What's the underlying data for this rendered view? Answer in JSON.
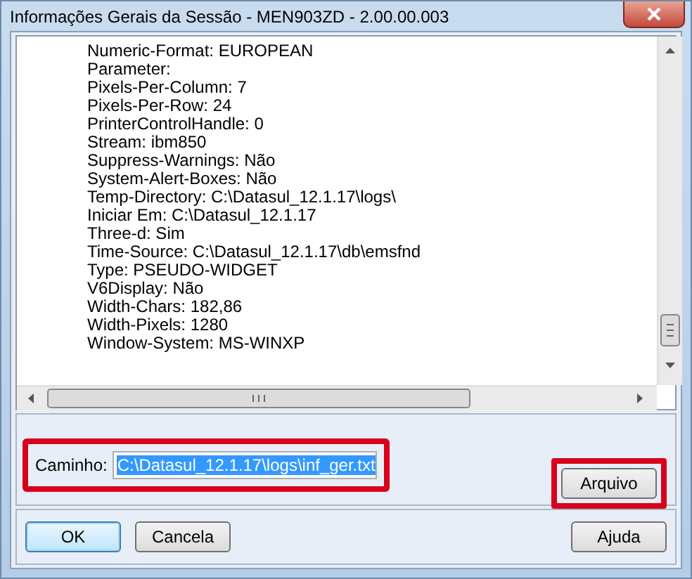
{
  "window": {
    "title": "Informações Gerais da Sessão - MEN903ZD - 2.00.00.003"
  },
  "lines": [
    "Numeric-Format: EUROPEAN",
    "Parameter:",
    "Pixels-Per-Column: 7",
    "Pixels-Per-Row: 24",
    "PrinterControlHandle: 0",
    "Stream: ibm850",
    "Suppress-Warnings: Não",
    "System-Alert-Boxes: Não",
    "Temp-Directory: C:\\Datasul_12.1.17\\logs\\",
    "Iniciar Em: C:\\Datasul_12.1.17",
    "Three-d: Sim",
    "Time-Source: C:\\Datasul_12.1.17\\db\\emsfnd",
    "Type: PSEUDO-WIDGET",
    "V6Display: Não",
    "Width-Chars: 182,86",
    "Width-Pixels: 1280",
    "Window-System: MS-WINXP"
  ],
  "path": {
    "label": "Caminho:",
    "value": "C:\\Datasul_12.1.17\\logs\\inf_ger.txt",
    "value_selected": true,
    "highlighted": true
  },
  "file_button": {
    "label": "Arquivo",
    "highlighted": true
  },
  "buttons": [
    {
      "label": "OK",
      "default": true
    },
    {
      "label": "Cancela",
      "default": false
    },
    {
      "label": "Ajuda",
      "default": false
    }
  ]
}
